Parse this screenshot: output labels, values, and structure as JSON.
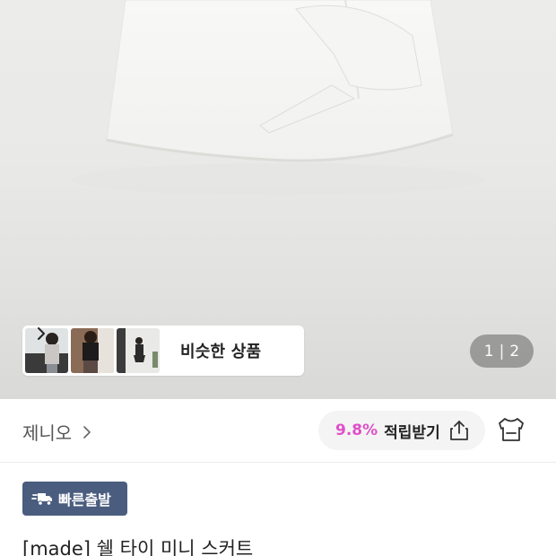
{
  "product_image": {
    "alt_icon": "white-wrap-skirt-photo"
  },
  "similar_products": {
    "label": "비슷한 상품",
    "thumbnails": [
      "thumbnail-1",
      "thumbnail-2",
      "thumbnail-3"
    ]
  },
  "image_pager": {
    "current": "1",
    "separator": "|",
    "total": "2"
  },
  "seller": {
    "name": "제니오"
  },
  "points": {
    "rate": "9.8%",
    "label": "적립받기"
  },
  "badge": {
    "label": "빠른출발"
  },
  "product": {
    "title": "[made] 쉘 타이 미니 스커트"
  },
  "colors": {
    "points_accent": "#e050c9",
    "badge_bg": "#4a5d7f"
  }
}
